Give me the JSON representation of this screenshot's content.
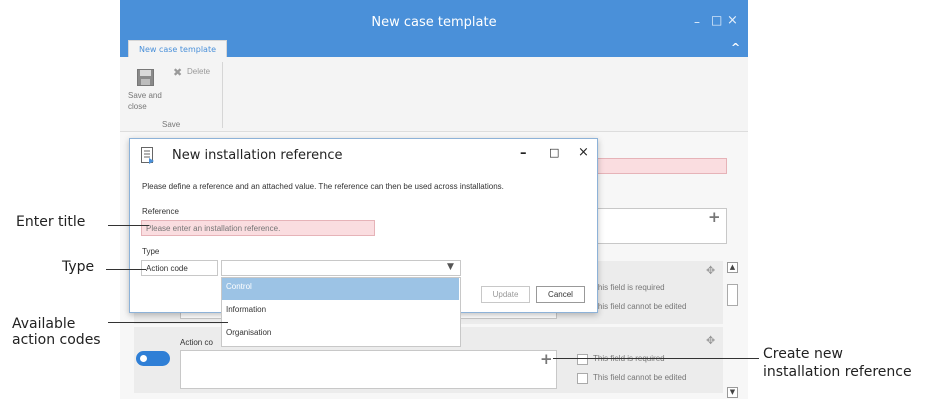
{
  "window": {
    "title": "New case template",
    "tab": "New case template",
    "minimize_glyph": "–",
    "maximize_glyph": "□",
    "close_glyph": "×",
    "collapse_glyph": "^"
  },
  "ribbon": {
    "save_close_label": "Save and close",
    "delete_label": "Delete",
    "group_label": "Save"
  },
  "dialog": {
    "title": "New installation reference",
    "description": "Please define a reference and an attached value. The reference can then be used across installations.",
    "reference_label": "Reference",
    "reference_placeholder": "Please enter an installation reference.",
    "type_label": "Type",
    "type_value": "Action code",
    "update_button": "Update",
    "cancel_button": "Cancel",
    "dropdown_options": [
      "Control",
      "Information",
      "Organisation"
    ],
    "minimize_glyph": "–",
    "maximize_glyph": "□",
    "close_glyph": "×"
  },
  "background": {
    "field_required_1": "This field is required",
    "field_readonly_1": "This field cannot be edited",
    "field_required_2": "This field is required",
    "field_readonly_2": "This field cannot be edited",
    "action_label": "Action co",
    "plus_glyph": "+"
  },
  "callouts": {
    "enter_title": "Enter title",
    "type": "Type",
    "available_line1": "Available",
    "available_line2": "action codes",
    "create_line1": "Create new",
    "create_line2": "installation reference"
  },
  "colors": {
    "accent": "#4a90d9",
    "error_bg": "#fadde0",
    "selected_option": "#9cc3e5"
  }
}
